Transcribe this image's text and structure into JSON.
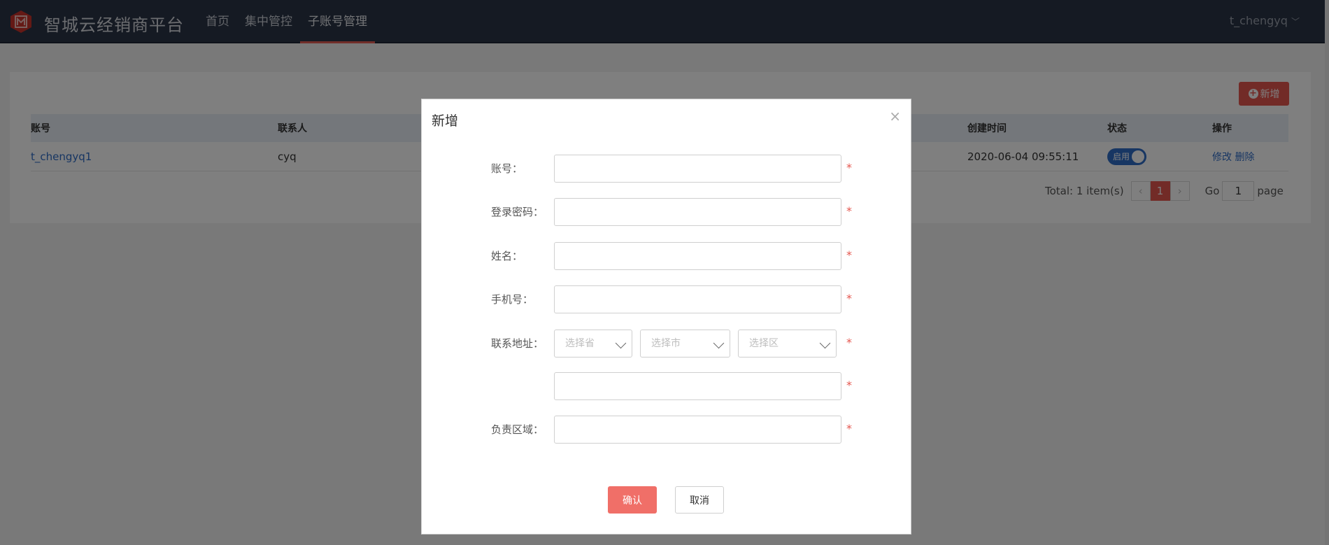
{
  "header": {
    "app_title": "智城云经销商平台",
    "nav": [
      {
        "label": "首页"
      },
      {
        "label": "集中管控"
      },
      {
        "label": "子账号管理"
      }
    ],
    "user": "t_chengyq"
  },
  "page": {
    "add_label": "新增",
    "table": {
      "headers": {
        "account": "账号",
        "contact": "联系人",
        "created": "创建时间",
        "status": "状态",
        "actions": "操作"
      },
      "rows": [
        {
          "account": "t_chengyq1",
          "contact": "cyq",
          "created": "2020-06-04 09:55:11",
          "status": "启用",
          "edit": "修改",
          "delete": "删除"
        }
      ]
    },
    "pagination": {
      "total": "Total: 1 item(s)",
      "current": "1",
      "go_label": "Go",
      "go_value": "1",
      "page_label": "page"
    }
  },
  "modal": {
    "title": "新增",
    "close": "×",
    "fields": {
      "account": "账号：",
      "password": "登录密码：",
      "name": "姓名：",
      "phone": "手机号：",
      "address": "联系地址：",
      "region": "负责区域："
    },
    "required_mark": "*",
    "selects": {
      "province": "选择省",
      "city": "选择市",
      "district": "选择区"
    },
    "confirm": "确认",
    "cancel": "取消"
  },
  "colors": {
    "header_bg": "#2a3447",
    "accent_red": "#e5574f",
    "link_blue": "#2f6cc6"
  }
}
